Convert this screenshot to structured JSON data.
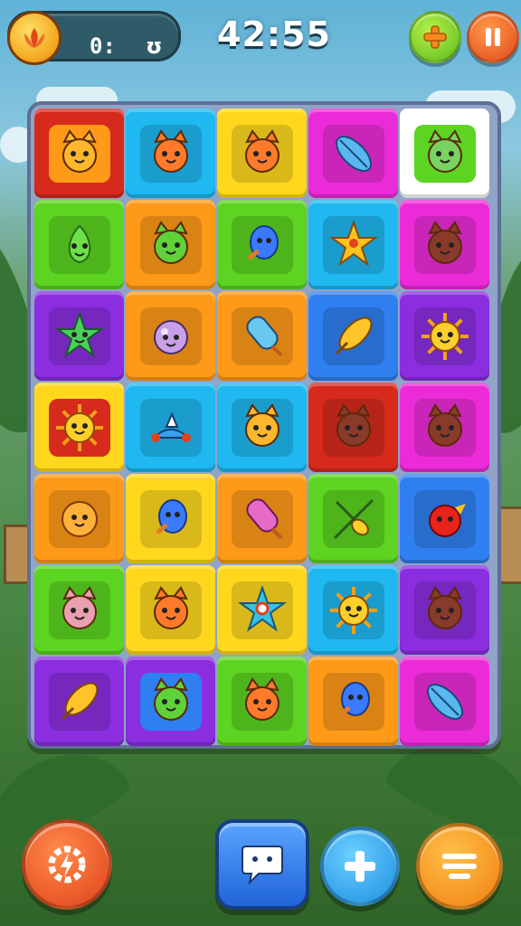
{
  "hud": {
    "score_text": "0:",
    "score_icon": "ʊ",
    "timer": "42:55"
  },
  "icons": {
    "score_badge": "lotus-icon",
    "add": "plus-icon",
    "pause": "pause-icon",
    "power": "lightning-gear-icon",
    "chat": "chat-bubble-icon",
    "plus": "plus-icon",
    "menu": "menu-icon"
  },
  "colors": {
    "red": "#d62a1c",
    "cyan": "#1fb8f0",
    "yellow": "#ffd81e",
    "magenta": "#ec2bd8",
    "green": "#5cd421",
    "orange": "#ff9a18",
    "purple": "#8a2ee0",
    "blue": "#2f7ff0"
  },
  "board": {
    "rows": [
      [
        {
          "bg": "red",
          "inner": "orange",
          "piece": "cat-face"
        },
        {
          "bg": "cyan",
          "inner": "cyan",
          "piece": "fox-face"
        },
        {
          "bg": "yellow",
          "inner": "yellow",
          "piece": "fox-face"
        },
        {
          "bg": "magenta",
          "inner": "magenta",
          "piece": "blue-leaf"
        },
        {
          "bg": "white",
          "inner": "green",
          "piece": "frog-face"
        }
      ],
      [
        {
          "bg": "green",
          "inner": "green",
          "piece": "green-blob"
        },
        {
          "bg": "orange",
          "inner": "orange",
          "piece": "green-cat"
        },
        {
          "bg": "green",
          "inner": "green",
          "piece": "blue-drop"
        },
        {
          "bg": "cyan",
          "inner": "cyan",
          "piece": "star"
        },
        {
          "bg": "magenta",
          "inner": "magenta",
          "piece": "bear-face"
        }
      ],
      [
        {
          "bg": "purple",
          "inner": "purple",
          "piece": "green-star-face"
        },
        {
          "bg": "orange",
          "inner": "orange",
          "piece": "bubble-face"
        },
        {
          "bg": "orange",
          "inner": "orange",
          "piece": "ice-pop"
        },
        {
          "bg": "blue",
          "inner": "blue",
          "piece": "yellow-leaf"
        },
        {
          "bg": "purple",
          "inner": "purple",
          "piece": "sun-face"
        }
      ],
      [
        {
          "bg": "yellow",
          "inner": "red",
          "piece": "sun-face"
        },
        {
          "bg": "cyan",
          "inner": "cyan",
          "piece": "blue-ship"
        },
        {
          "bg": "cyan",
          "inner": "cyan",
          "piece": "cat-face"
        },
        {
          "bg": "red",
          "inner": "red",
          "piece": "bear-face"
        },
        {
          "bg": "magenta",
          "inner": "magenta",
          "piece": "bear-face"
        }
      ],
      [
        {
          "bg": "orange",
          "inner": "orange",
          "piece": "yellow-ball"
        },
        {
          "bg": "yellow",
          "inner": "yellow",
          "piece": "blue-drop"
        },
        {
          "bg": "orange",
          "inner": "orange",
          "piece": "pink-pop"
        },
        {
          "bg": "green",
          "inner": "green",
          "piece": "spear-fish"
        },
        {
          "bg": "blue",
          "inner": "blue",
          "piece": "red-bird"
        }
      ],
      [
        {
          "bg": "green",
          "inner": "green",
          "piece": "pink-cat"
        },
        {
          "bg": "yellow",
          "inner": "yellow",
          "piece": "fox-face"
        },
        {
          "bg": "yellow",
          "inner": "yellow",
          "piece": "blue-star"
        },
        {
          "bg": "cyan",
          "inner": "cyan",
          "piece": "sun-face"
        },
        {
          "bg": "purple",
          "inner": "purple",
          "piece": "bear-face"
        }
      ],
      [
        {
          "bg": "purple",
          "inner": "purple",
          "piece": "yellow-leaf"
        },
        {
          "bg": "purple",
          "inner": "blue",
          "piece": "green-cat"
        },
        {
          "bg": "green",
          "inner": "green",
          "piece": "fox-face"
        },
        {
          "bg": "orange",
          "inner": "orange",
          "piece": "blue-drop"
        },
        {
          "bg": "magenta",
          "inner": "magenta",
          "piece": "blue-leaf"
        }
      ]
    ]
  }
}
